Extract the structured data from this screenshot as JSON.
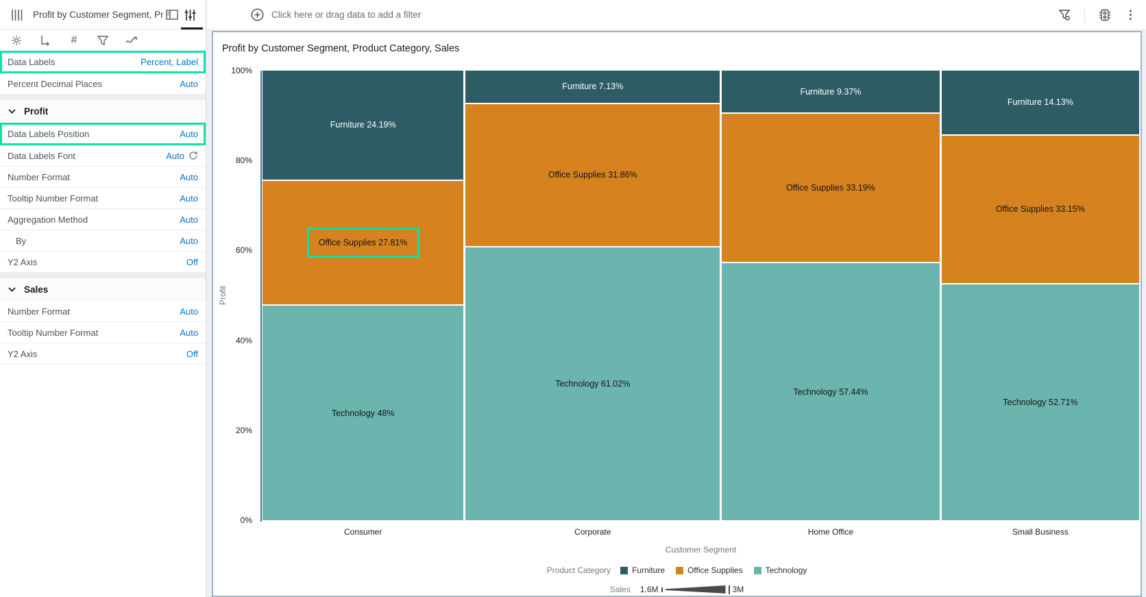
{
  "left_panel": {
    "title": "Profit by Customer Segment, Pr...",
    "header_icons": [
      "mekko-chart-icon",
      "grammar-panel-icon",
      "properties-panel-icon"
    ],
    "tool_icons": [
      "general-settings-icon",
      "axis-icon",
      "values-icon",
      "filter-icon",
      "analytics-icon"
    ],
    "general_rows": [
      {
        "label": "Data Labels",
        "value": "Percent, Label",
        "highlighted": true
      },
      {
        "label": "Percent Decimal Places",
        "value": "Auto"
      }
    ],
    "sections": [
      {
        "title": "Profit",
        "rows": [
          {
            "label": "Data Labels Position",
            "value": "Auto",
            "highlighted": true
          },
          {
            "label": "Data Labels Font",
            "value": "Auto",
            "refresh_icon": true
          },
          {
            "label": "Number Format",
            "value": "Auto"
          },
          {
            "label": "Tooltip Number Format",
            "value": "Auto"
          },
          {
            "label": "Aggregation Method",
            "value": "Auto"
          },
          {
            "label": "By",
            "value": "Auto",
            "indent": true
          },
          {
            "label": "Y2 Axis",
            "value": "Off"
          }
        ]
      },
      {
        "title": "Sales",
        "rows": [
          {
            "label": "Number Format",
            "value": "Auto"
          },
          {
            "label": "Tooltip Number Format",
            "value": "Auto"
          },
          {
            "label": "Y2 Axis",
            "value": "Off"
          }
        ]
      }
    ]
  },
  "filter_bar": {
    "hint": "Click here or drag data to add a filter"
  },
  "top_right_icons": [
    "filter-settings-icon",
    "canvas-properties-icon",
    "kebab-menu-icon"
  ],
  "kebab_glyph": "⋮",
  "chart_data": {
    "type": "marimekko",
    "title": "Profit by Customer Segment, Product Category, Sales",
    "xlabel": "Customer Segment",
    "ylabel": "Profit",
    "y_ticks": [
      "100%",
      "80%",
      "60%",
      "40%",
      "20%",
      "0%"
    ],
    "ylim": [
      0,
      100
    ],
    "categories": [
      "Consumer",
      "Corporate",
      "Home Office",
      "Small Business"
    ],
    "column_width_pct": [
      23.1,
      29.2,
      25.0,
      22.7
    ],
    "series": [
      "Furniture",
      "Office Supplies",
      "Technology"
    ],
    "series_colors": [
      "#2E5C65",
      "#D6821E",
      "#6CB5AE"
    ],
    "label_colors": [
      "#ffffff",
      "#151515",
      "#151515"
    ],
    "values_pct": [
      [
        24.19,
        27.81,
        48
      ],
      [
        7.13,
        31.86,
        61.02
      ],
      [
        9.37,
        33.19,
        57.44
      ],
      [
        14.13,
        33.15,
        52.71
      ]
    ],
    "label_texts": [
      [
        "Furniture 24.19%",
        "Office Supplies 27.81%",
        "Technology 48%"
      ],
      [
        "Furniture 7.13%",
        "Office Supplies 31.86%",
        "Technology 61.02%"
      ],
      [
        "Furniture 9.37%",
        "Office Supplies 33.19%",
        "Technology 57.44%"
      ],
      [
        "Furniture 14.13%",
        "Office Supplies 33.15%",
        "Technology 52.71%"
      ]
    ],
    "highlight": {
      "category": "Consumer",
      "series": "Office Supplies"
    },
    "legend": {
      "category_title": "Product Category",
      "items": [
        "Furniture",
        "Office Supplies",
        "Technology"
      ],
      "sales_title": "Sales",
      "sales_min": "1.6M",
      "sales_max": "3M",
      "position": "bottom"
    },
    "accent_highlight_color": "#10E1A6"
  }
}
